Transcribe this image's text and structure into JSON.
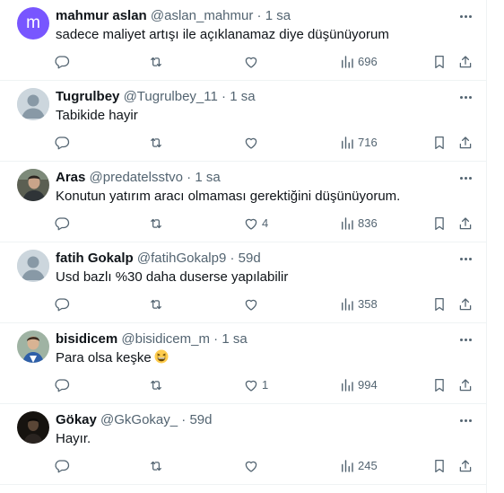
{
  "replies": [
    {
      "name": "mahmur aslan",
      "handle": "@aslan_mahmur",
      "sep": "·",
      "time": "1 sa",
      "text": "sadece maliyet artışı ile açıklanamaz diye düşünüyorum",
      "avatar": {
        "kind": "letter",
        "letter": "m",
        "color": "#7856ff"
      },
      "stats": {
        "replies": "",
        "retweets": "",
        "likes": "",
        "views": "696"
      }
    },
    {
      "name": "Tugrulbey",
      "handle": "@Tugrulbey_11",
      "sep": "·",
      "time": "1 sa",
      "text": "Tabikide hayir",
      "avatar": {
        "kind": "default"
      },
      "stats": {
        "replies": "",
        "retweets": "",
        "likes": "",
        "views": "716"
      }
    },
    {
      "name": "Aras",
      "handle": "@predatelsstvo",
      "sep": "·",
      "time": "1 sa",
      "text": "Konutun yatırım aracı olmaması gerektiğini düşünüyorum.",
      "avatar": {
        "kind": "photo"
      },
      "stats": {
        "replies": "",
        "retweets": "",
        "likes": "4",
        "views": "836"
      }
    },
    {
      "name": "fatih Gokalp",
      "handle": "@fatihGokalp9",
      "sep": "·",
      "time": "59d",
      "text": "Usd bazlı %30 daha duserse yapılabilir",
      "avatar": {
        "kind": "default"
      },
      "stats": {
        "replies": "",
        "retweets": "",
        "likes": "",
        "views": "358"
      }
    },
    {
      "name": "bisidicem",
      "handle": "@bisidicem_m",
      "sep": "·",
      "time": "1 sa",
      "text": "Para olsa keşke",
      "emoji": "grinning-squinting-face",
      "avatar": {
        "kind": "photo"
      },
      "stats": {
        "replies": "",
        "retweets": "",
        "likes": "1",
        "views": "994"
      }
    },
    {
      "name": "Gökay",
      "handle": "@GkGokay_",
      "sep": "·",
      "time": "59d",
      "text": "Hayır.",
      "avatar": {
        "kind": "photo"
      },
      "stats": {
        "replies": "",
        "retweets": "",
        "likes": "",
        "views": "245"
      }
    }
  ],
  "icons": {
    "more": "more-horizontal-icon",
    "reply": "reply-bubble-icon",
    "retweet": "retweet-icon",
    "like": "heart-icon",
    "views": "views-bar-chart-icon",
    "bookmark": "bookmark-icon",
    "share": "share-upload-icon"
  },
  "colors": {
    "text": "#0f1419",
    "muted": "#536471",
    "divider": "#eff3f4",
    "letter_avatar": "#7856ff"
  }
}
